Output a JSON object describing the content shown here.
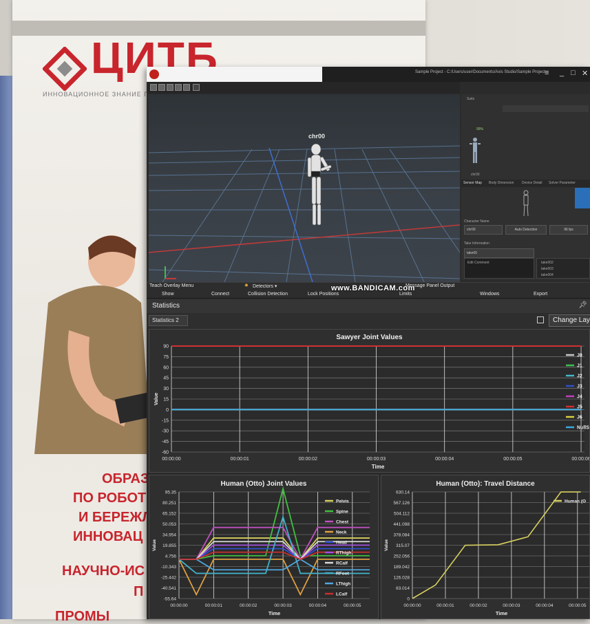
{
  "background": {
    "logo": "ЦИТБ",
    "logo_subtitle": "ИННОВАЦИОННОЕ ЗНАНИЕ ГАРАН",
    "slogans": [
      "ОБРАЗ",
      "ПО РОБОТ",
      "И БЕРЕЖЛ",
      "ИННОВАЦ",
      "НАУЧНО-ИС",
      "П",
      "ПРОМЫ"
    ]
  },
  "window": {
    "title": "Sample Project - C:/Users/user/Documents/Axis Studio/Sample Project",
    "controls": [
      "_",
      "□",
      "✕"
    ]
  },
  "viewport": {
    "character_label": "chr00",
    "watermark": "www.BANDICAM.com"
  },
  "side_panel": {
    "tabs": [
      "Suits"
    ],
    "battery": "99%",
    "suit_name": "chr00",
    "subtabs": [
      "Sensor Map",
      "Body Dimension",
      "Device Detail",
      "Solver Parameter"
    ],
    "character_name_label": "Character Name",
    "character_name_value": "chr00",
    "auto_detection": "Auto Detection",
    "fps": "96 fps",
    "take_info_label": "Take Information",
    "take_name": "take00",
    "edit_comment": "Edit Comment",
    "takes": [
      "take002",
      "take003",
      "take004"
    ]
  },
  "menubar": {
    "top_items": [
      "Teach Overlay Menu",
      "Detectors ▾",
      "Message Panel Output"
    ],
    "bottom_items": [
      "Show",
      "Connect",
      "Collision Detection",
      "Lock Positions",
      "Limits",
      "Windows",
      "Export"
    ]
  },
  "statistics": {
    "header": "Statistics",
    "selected": "Statistics 2",
    "change_layout": "Change Layout"
  },
  "charts": {
    "sawyer": {
      "title": "Sawyer Joint Values",
      "ylabel": "Value",
      "xlabel": "Time",
      "yticks": [
        "90",
        "75",
        "60",
        "45",
        "30",
        "15",
        "0",
        "-15",
        "-30",
        "-45",
        "-60"
      ],
      "xticks": [
        "00:00:00",
        "00:00:01",
        "00:00:02",
        "00:00:03",
        "00:00:04",
        "00:00:05",
        "00:00:06"
      ],
      "legend": [
        "J0",
        "J1",
        "J2",
        "J3",
        "J4",
        "J5",
        "J6",
        "NullSp"
      ]
    },
    "otto_joints": {
      "title": "Human (Otto) Joint Values",
      "ylabel": "Value",
      "xlabel": "Time",
      "yticks": [
        "95.35",
        "80.251",
        "65.152",
        "50.053",
        "34.954",
        "19.855",
        "4.756",
        "-10.343",
        "-25.442",
        "-40.541",
        "-55.64"
      ],
      "xticks": [
        "00:00:00",
        "00:00:01",
        "00:00:02",
        "00:00:03",
        "00:00:04",
        "00:00:05"
      ],
      "legend": [
        "Pelvis",
        "Spine",
        "Chest",
        "Neck",
        "Head",
        "RThigh",
        "RCalf",
        "RFoot",
        "LThigh",
        "LCalf"
      ]
    },
    "otto_travel": {
      "title": "Human (Otto): Travel Distance",
      "ylabel": "Value",
      "xlabel": "Time",
      "yticks": [
        "630.14",
        "567.126",
        "504.112",
        "441.098",
        "378.084",
        "315.07",
        "252.056",
        "189.042",
        "126.028",
        "63.014",
        "0"
      ],
      "xticks": [
        "00:00:00",
        "00:00:01",
        "00:00:02",
        "00:00:03",
        "00:00:04",
        "00:00:05"
      ],
      "legend": [
        "Human (O"
      ]
    }
  },
  "chart_data": [
    {
      "type": "line",
      "title": "Sawyer Joint Values",
      "xlabel": "Time",
      "ylabel": "Value",
      "ylim": [
        -60,
        90
      ],
      "x": [
        "00:00:00",
        "00:00:01",
        "00:00:02",
        "00:00:03",
        "00:00:04",
        "00:00:05",
        "00:00:06"
      ],
      "series": [
        {
          "name": "J0",
          "color": "#c8c8c8",
          "values": [
            0,
            0,
            0,
            0,
            0,
            0,
            0
          ]
        },
        {
          "name": "J1",
          "color": "#3fbf4f",
          "values": [
            0,
            0,
            0,
            0,
            0,
            0,
            0
          ]
        },
        {
          "name": "J2",
          "color": "#46b8c8",
          "values": [
            0,
            0,
            0,
            0,
            0,
            0,
            0
          ]
        },
        {
          "name": "J3",
          "color": "#3050c8",
          "values": [
            0,
            0,
            0,
            0,
            0,
            0,
            0
          ]
        },
        {
          "name": "J4",
          "color": "#c040c0",
          "values": [
            0,
            0,
            0,
            0,
            0,
            0,
            0
          ]
        },
        {
          "name": "J5",
          "color": "#d03030",
          "values": [
            90,
            90,
            90,
            90,
            90,
            90,
            90
          ]
        },
        {
          "name": "J6",
          "color": "#d8d040",
          "values": [
            0,
            0,
            0,
            0,
            0,
            0,
            0
          ]
        },
        {
          "name": "NullSp",
          "color": "#40a8e0",
          "values": [
            0,
            0,
            0,
            0,
            0,
            0,
            0
          ]
        }
      ]
    },
    {
      "type": "line",
      "title": "Human (Otto) Joint Values",
      "xlabel": "Time",
      "ylabel": "Value",
      "ylim": [
        -55.64,
        95.35
      ],
      "x": [
        0,
        0.5,
        1,
        1.5,
        2,
        2.5,
        3,
        3.5,
        4,
        4.5,
        5,
        5.5
      ],
      "series": [
        {
          "name": "Pelvis",
          "color": "#d8d060",
          "values": [
            0,
            0,
            30,
            30,
            30,
            30,
            30,
            0,
            30,
            30,
            30,
            30
          ]
        },
        {
          "name": "Spine",
          "color": "#40c040",
          "values": [
            0,
            0,
            5,
            5,
            5,
            5,
            100,
            5,
            5,
            5,
            5,
            5
          ]
        },
        {
          "name": "Chest",
          "color": "#c050c0",
          "values": [
            0,
            0,
            45,
            45,
            45,
            45,
            45,
            0,
            45,
            45,
            45,
            45
          ]
        },
        {
          "name": "Neck",
          "color": "#e0a040",
          "values": [
            0,
            -50,
            0,
            0,
            0,
            0,
            0,
            -50,
            0,
            0,
            0,
            0
          ]
        },
        {
          "name": "Head",
          "color": "#3050d0",
          "values": [
            0,
            0,
            15,
            15,
            15,
            15,
            15,
            0,
            15,
            15,
            15,
            15
          ]
        },
        {
          "name": "RThigh",
          "color": "#a050e0",
          "values": [
            0,
            0,
            20,
            20,
            20,
            20,
            20,
            0,
            20,
            20,
            20,
            20
          ]
        },
        {
          "name": "RCalf",
          "color": "#d8d8d8",
          "values": [
            0,
            0,
            25,
            25,
            25,
            25,
            25,
            0,
            25,
            25,
            25,
            25
          ]
        },
        {
          "name": "RFoot",
          "color": "#40b0c8",
          "values": [
            0,
            -20,
            -20,
            -20,
            -20,
            -20,
            60,
            -20,
            -20,
            -20,
            -20,
            -20
          ]
        },
        {
          "name": "LThigh",
          "color": "#50a8e0",
          "values": [
            0,
            0,
            -15,
            -15,
            -15,
            -15,
            -15,
            0,
            -15,
            -15,
            -15,
            -15
          ]
        },
        {
          "name": "LCalf",
          "color": "#c83030",
          "values": [
            0,
            0,
            10,
            10,
            10,
            10,
            10,
            0,
            10,
            10,
            10,
            10
          ]
        }
      ]
    },
    {
      "type": "line",
      "title": "Human (Otto): Travel Distance",
      "xlabel": "Time",
      "ylabel": "Value",
      "ylim": [
        0,
        630.14
      ],
      "x": [
        0,
        0.7,
        1.6,
        2.6,
        3.5,
        4.5,
        5.1
      ],
      "series": [
        {
          "name": "Human (O",
          "color": "#d8d060",
          "values": [
            0,
            80,
            315,
            318,
            365,
            630,
            630
          ]
        }
      ]
    }
  ],
  "colors": {
    "accent": "#c8252d",
    "panel": "#2f2f2f",
    "grid": "#cfcfcf"
  }
}
